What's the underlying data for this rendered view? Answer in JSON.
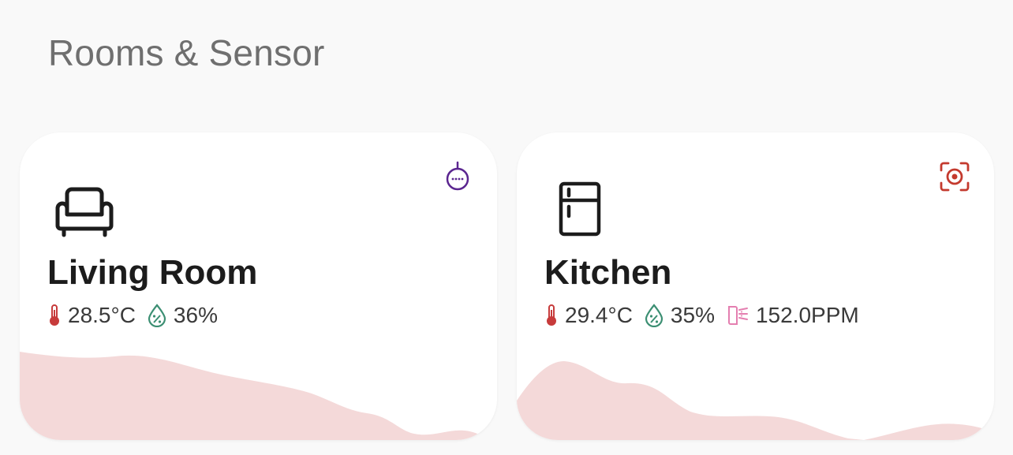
{
  "header": {
    "title": "Rooms & Sensor"
  },
  "colors": {
    "temperature": "#c73b3b",
    "humidity": "#3c8f73",
    "air_quality": "#e47fb0",
    "wave_fill": "#f4d9d9",
    "presence_purple": "#5b2690",
    "motion_red": "#c43a2e"
  },
  "rooms": [
    {
      "name": "Living Room",
      "room_icon": "sofa-icon",
      "status_icon": "presence-sensor-icon",
      "temperature": "28.5°C",
      "humidity": "36%"
    },
    {
      "name": "Kitchen",
      "room_icon": "fridge-icon",
      "status_icon": "motion-detect-icon",
      "temperature": "29.4°C",
      "humidity": "35%",
      "air_quality": "152.0PPM"
    }
  ]
}
